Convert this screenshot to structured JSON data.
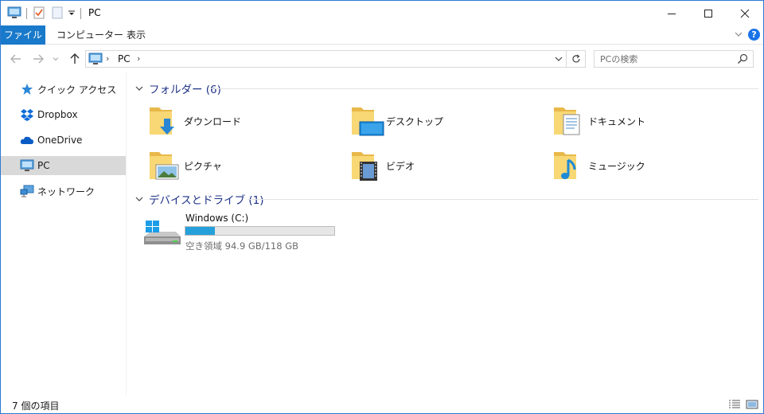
{
  "window": {
    "title": "PC",
    "controls": {
      "minimize": "minimize",
      "maximize": "maximize",
      "close": "close"
    }
  },
  "ribbon": {
    "tabs": [
      {
        "label": "ファイル",
        "active": true
      },
      {
        "label": "コンピューター",
        "active": false
      },
      {
        "label": "表示",
        "active": false
      }
    ],
    "help_label": "?"
  },
  "address": {
    "path": [
      "PC"
    ],
    "search_placeholder": "PCの検索"
  },
  "sidebar": {
    "items": [
      {
        "label": "クイック アクセス",
        "icon": "star-icon",
        "selected": false
      },
      {
        "label": "Dropbox",
        "icon": "dropbox-icon",
        "selected": false
      },
      {
        "label": "OneDrive",
        "icon": "onedrive-icon",
        "selected": false
      },
      {
        "label": "PC",
        "icon": "pc-icon",
        "selected": true
      },
      {
        "label": "ネットワーク",
        "icon": "network-icon",
        "selected": false
      }
    ]
  },
  "main": {
    "folders_header": "フォルダー (6)",
    "folders": [
      {
        "label": "ダウンロード",
        "icon": "download-folder-icon"
      },
      {
        "label": "デスクトップ",
        "icon": "desktop-folder-icon"
      },
      {
        "label": "ドキュメント",
        "icon": "documents-folder-icon"
      },
      {
        "label": "ピクチャ",
        "icon": "pictures-folder-icon"
      },
      {
        "label": "ビデオ",
        "icon": "videos-folder-icon"
      },
      {
        "label": "ミュージック",
        "icon": "music-folder-icon"
      }
    ],
    "devices_header": "デバイスとドライブ (1)",
    "drives": [
      {
        "label": "Windows (C:)",
        "free_text": "空き領域 94.9 GB/118 GB",
        "used_fraction": 0.196
      }
    ]
  },
  "status": {
    "item_count": "7 個の項目"
  },
  "colors": {
    "accent": "#1979ca",
    "group_header": "#1e3287",
    "drive_fill": "#26a0da",
    "selection": "#d9d9d9",
    "folder": "#f8d775"
  }
}
